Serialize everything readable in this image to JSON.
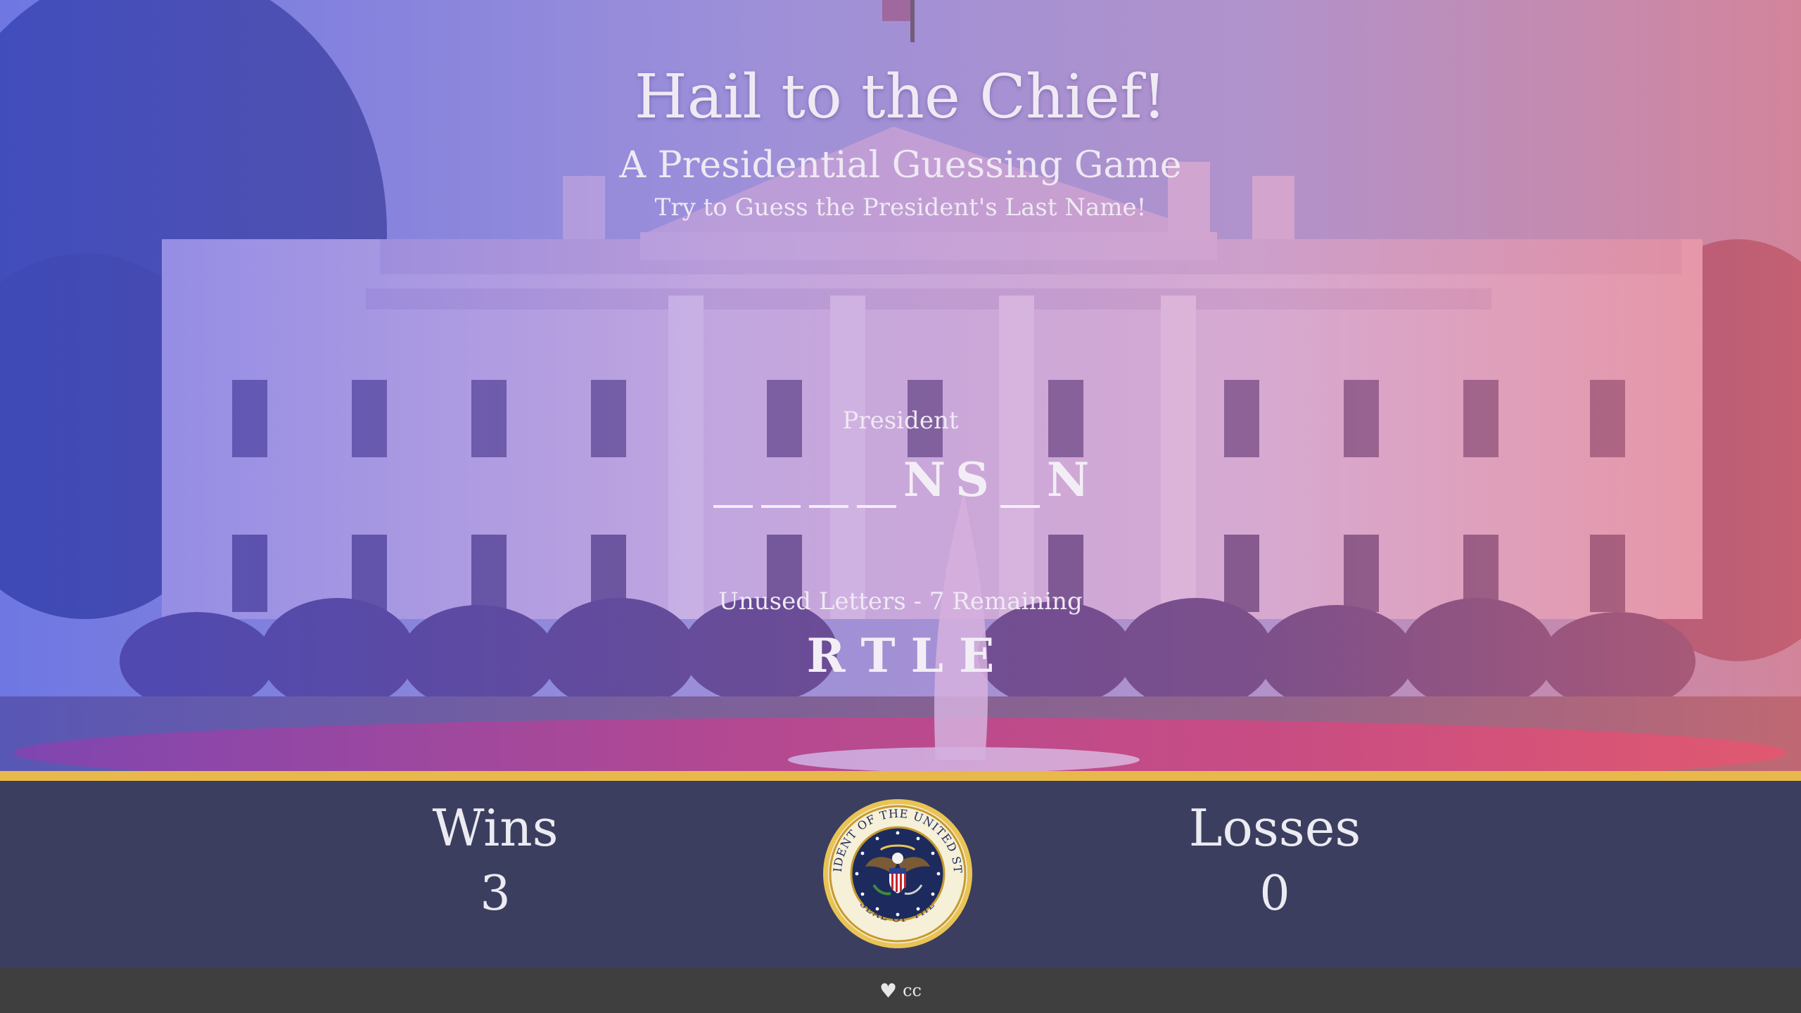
{
  "header": {
    "title": "Hail to the Chief!",
    "subtitle": "A Presidential Guessing Game",
    "instruction": "Try to Guess the President's Last Name!"
  },
  "puzzle": {
    "label": "President",
    "letters": [
      "",
      "",
      "",
      "",
      "N",
      "S",
      "",
      "N"
    ]
  },
  "unused": {
    "label": "Unused Letters - 7 Remaining",
    "letters": [
      "R",
      "T",
      "L",
      "E"
    ]
  },
  "scores": {
    "wins_label": "Wins",
    "wins": "3",
    "losses_label": "Losses",
    "losses": "0"
  },
  "seal": {
    "icon": "presidential-seal-icon",
    "text_top": "PRESIDENT OF THE UNITED STATES",
    "text_bottom": "SEAL OF THE"
  },
  "footer": {
    "icon": "heart-icon",
    "text": "cc"
  },
  "colors": {
    "gold": "#e8b84a",
    "scorebar": "#3b3e5f",
    "footer": "#3f3f3f"
  }
}
